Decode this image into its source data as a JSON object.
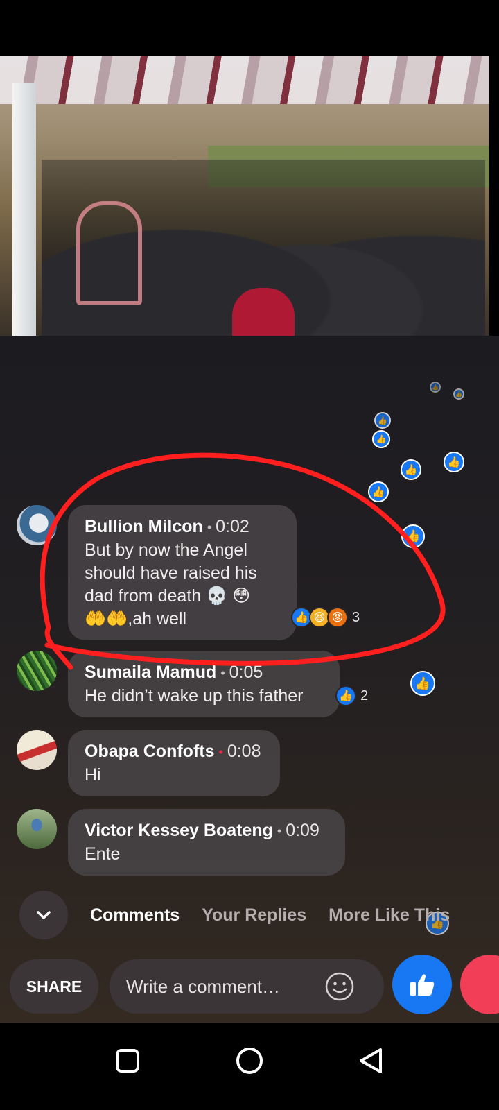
{
  "video": {
    "content": "funeral gathering video frame"
  },
  "comments": [
    {
      "author": "Bullion Milcon",
      "time": "0:02",
      "text_lines": [
        "But by now the Angel",
        "should have raised his",
        "dad from death 💀 😳",
        "🤲🤲,ah well"
      ],
      "reactions": [
        "like",
        "haha",
        "angry"
      ],
      "reaction_count": "3"
    },
    {
      "author": "Sumaila Mamud",
      "time": "0:05",
      "text_lines": [
        "He didn’t wake up this father"
      ],
      "reactions": [
        "like"
      ],
      "reaction_count": "2"
    },
    {
      "author": "Obapa Confofts",
      "time": "0:08",
      "text_lines": [
        "Hi"
      ]
    },
    {
      "author": "Victor Kessey Boateng",
      "time": "0:09",
      "text_lines": [
        "Ente"
      ]
    }
  ],
  "tabs": {
    "comments": "Comments",
    "your_replies": "Your Replies",
    "more_like_this": "More Like This"
  },
  "composer": {
    "share": "SHARE",
    "placeholder": "Write a comment…"
  },
  "colors": {
    "like_blue": "#1877f2",
    "love_red": "#f33e58",
    "highlight_red": "#ff1f1f"
  },
  "icons": [
    "like-icon",
    "haha-icon",
    "angry-icon",
    "chevron-down-icon",
    "smiley-icon",
    "square-icon",
    "circle-icon",
    "triangle-back-icon"
  ]
}
